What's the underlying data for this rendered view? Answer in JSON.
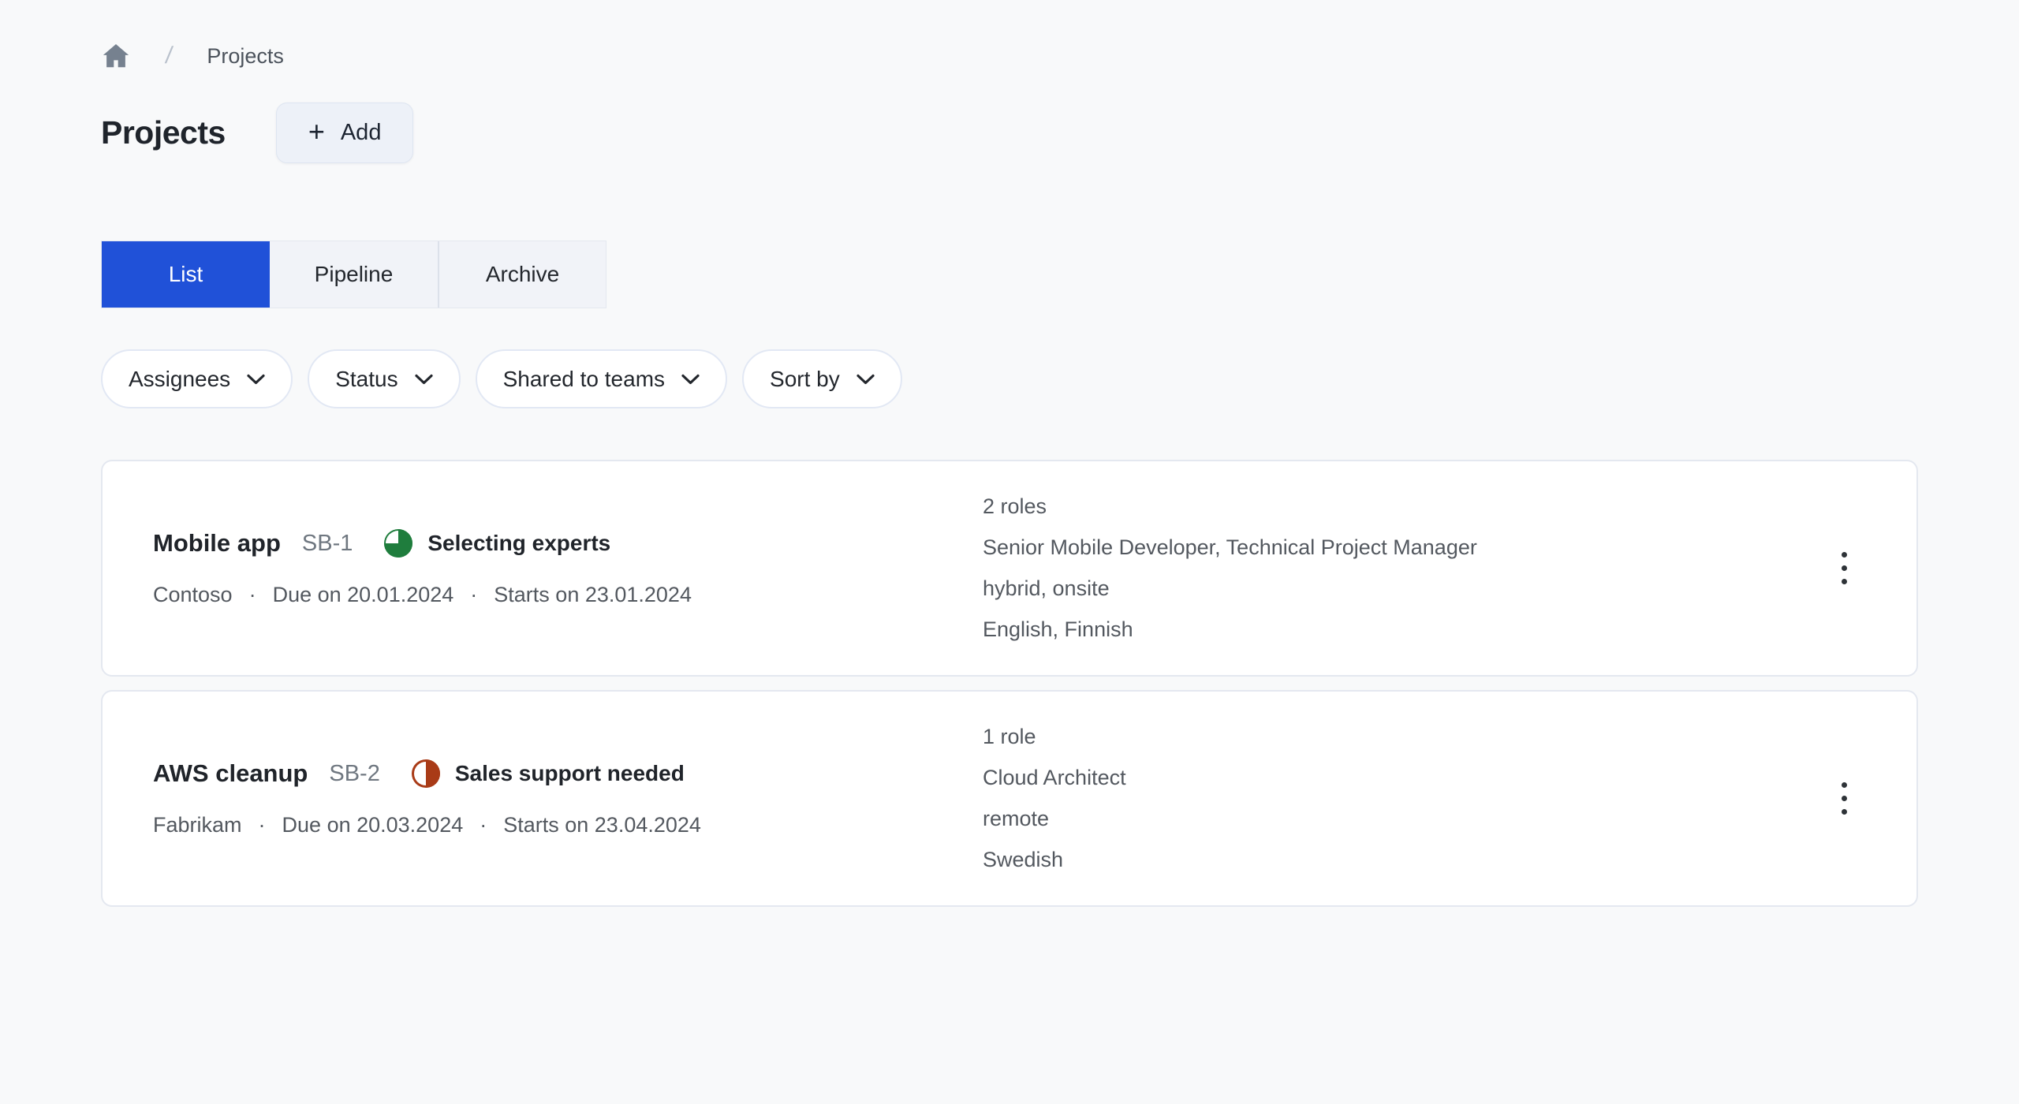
{
  "ui": {
    "dot": "·",
    "breadcrumb_separator": "/",
    "plus": "+"
  },
  "colors": {
    "accent_blue": "#2051D8",
    "status_green": "#1F7D3D",
    "status_red": "#A93B17",
    "page_background": "#F8F9FA"
  },
  "breadcrumb": {
    "home_icon": "home-icon",
    "current": "Projects"
  },
  "header": {
    "title": "Projects",
    "add_button_label": "Add"
  },
  "tabs": [
    {
      "label": "List",
      "active": true
    },
    {
      "label": "Pipeline",
      "active": false
    },
    {
      "label": "Archive",
      "active": false
    }
  ],
  "filters": [
    {
      "label": "Assignees"
    },
    {
      "label": "Status"
    },
    {
      "label": "Shared to teams"
    },
    {
      "label": "Sort by"
    }
  ],
  "projects": [
    {
      "name": "Mobile app",
      "code": "SB-1",
      "status": {
        "label": "Selecting experts",
        "icon": "pie-three-quarters-icon",
        "color": "#1F7D3D"
      },
      "client": "Contoso",
      "due": "Due on 20.01.2024",
      "starts": "Starts on 23.01.2024",
      "roles_count": "2 roles",
      "roles": "Senior Mobile Developer, Technical Project Manager",
      "work_mode": "hybrid, onsite",
      "languages": "English, Finnish"
    },
    {
      "name": "AWS cleanup",
      "code": "SB-2",
      "status": {
        "label": "Sales support needed",
        "icon": "pie-half-icon",
        "color": "#A93B17"
      },
      "client": "Fabrikam",
      "due": "Due on 20.03.2024",
      "starts": "Starts on 23.04.2024",
      "roles_count": "1 role",
      "roles": "Cloud Architect",
      "work_mode": "remote",
      "languages": "Swedish"
    }
  ]
}
